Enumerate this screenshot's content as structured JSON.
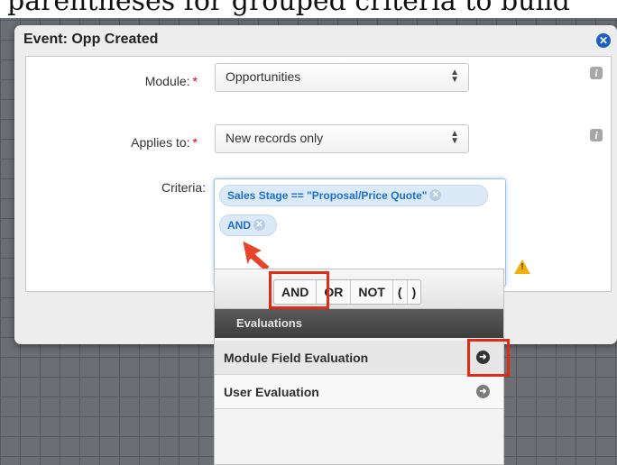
{
  "caption": "parentheses for grouped criteria to build",
  "dialog": {
    "title": "Event: Opp Created",
    "close_icon": "close-circle-icon"
  },
  "form": {
    "module_label": "Module:",
    "module_value": "Opportunities",
    "applies_label": "Applies to:",
    "applies_value": "New records only",
    "criteria_label": "Criteria:",
    "required_mark": "*"
  },
  "criteria": {
    "pills": [
      "Sales Stage == \"Proposal/Price Quote\"",
      "AND"
    ],
    "remove_icon": "x-circle-icon"
  },
  "popup": {
    "operators": [
      "AND",
      "OR",
      "NOT",
      "(",
      ")"
    ],
    "section_title": "Evaluations",
    "items": [
      "Module Field Evaluation",
      "User Evaluation"
    ]
  },
  "colors": {
    "accent_blue": "#1a6fd1",
    "highlight_red": "#e02b17",
    "warning": "#f0b20a"
  }
}
